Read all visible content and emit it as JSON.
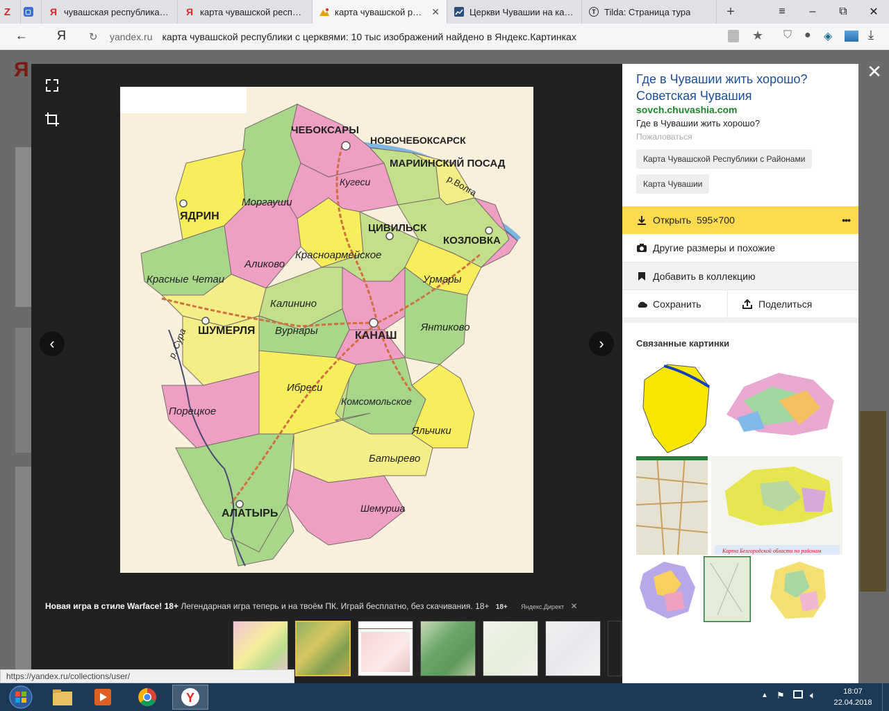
{
  "browser": {
    "tabs": [
      {
        "label": "",
        "icon": "zotero-icon",
        "active": false
      },
      {
        "label": "",
        "icon": "message-icon",
        "active": false
      },
      {
        "label": "чувашская республика фо",
        "icon": "yandex-icon",
        "active": false
      },
      {
        "label": "карта чувашской республ",
        "icon": "yandex-icon",
        "active": false
      },
      {
        "label": "карта чувашской респу",
        "icon": "yandex-images-icon",
        "active": true
      },
      {
        "label": "Церкви Чувашии на карте",
        "icon": "chart-icon",
        "active": false
      },
      {
        "label": "Tilda: Страница тура",
        "icon": "tilda-icon",
        "active": false
      }
    ],
    "new_tab": "+",
    "window_controls": [
      "≡",
      "–",
      "⧉",
      "✕"
    ],
    "back": "←",
    "logo": "Я",
    "url_domain": "yandex.ru",
    "url_title": "карта чувашской республики с церквями: 10 тыс изображений найдено в Яндекс.Картинках"
  },
  "viewer": {
    "map": {
      "labels": {
        "cheboksary": "ЧЕБОКСАРЫ",
        "novocheboksarsk": "НОВОЧЕБОКСАРСК",
        "mariinsky": "МАРИИНСКИЙ ПОСАД",
        "volga": "р.Волга",
        "kugesi": "Кугеси",
        "morgaushi": "Моргауши",
        "yadrin": "ЯДРИН",
        "tsivilsk": "ЦИВИЛЬСК",
        "kozlovka": "КОЗЛОВКА",
        "alikovo": "Аликово",
        "krasnoarm": "Красноармейское",
        "urmary": "Урмары",
        "krasnye_chetai": "Красные Четаи",
        "kalinino": "Калинино",
        "shumerlya": "ШУМЕРЛЯ",
        "vurnary": "Вурнары",
        "kanash": "КАНАШ",
        "yantikovo": "Янтиково",
        "sura": "р. Сура",
        "ibresi": "Ибреси",
        "komsomolskoe": "Комсомольское",
        "poretskoe": "Порецкое",
        "yalchiki": "Яльчики",
        "batyrevo": "Батырево",
        "alatyr": "АЛАТЫРЬ",
        "shemursha": "Шемурша"
      }
    },
    "ad": {
      "title": "Новая игра в стиле Warface! 18+",
      "text": "Легендарная игра теперь и на твоём ПК. Играй бесплатно, без скачивания. 18+",
      "age": "18+",
      "source": "Яндекс.Директ",
      "close": "✕"
    }
  },
  "panel": {
    "title": "Где в Чувашии жить хорошо? Советская Чувашия",
    "domain": "sovch.chuvashia.com",
    "description": "Где в Чувашии жить хорошо?",
    "report": "Пожаловаться",
    "chips": [
      "Карта Чувашской Республики с Районами",
      "Карта Чувашии"
    ],
    "open_label": "Открыть",
    "open_size": "595×700",
    "more": "•••",
    "other_sizes": "Другие размеры и похожие",
    "add_collection": "Добавить в коллекцию",
    "save": "Сохранить",
    "share": "Поделиться",
    "related_title": "Связанные картинки",
    "related_caption": "Карта Белгородской области по районам"
  },
  "status_url": "https://yandex.ru/collections/user/",
  "taskbar": {
    "time": "18:07",
    "date": "22.04.2018"
  }
}
